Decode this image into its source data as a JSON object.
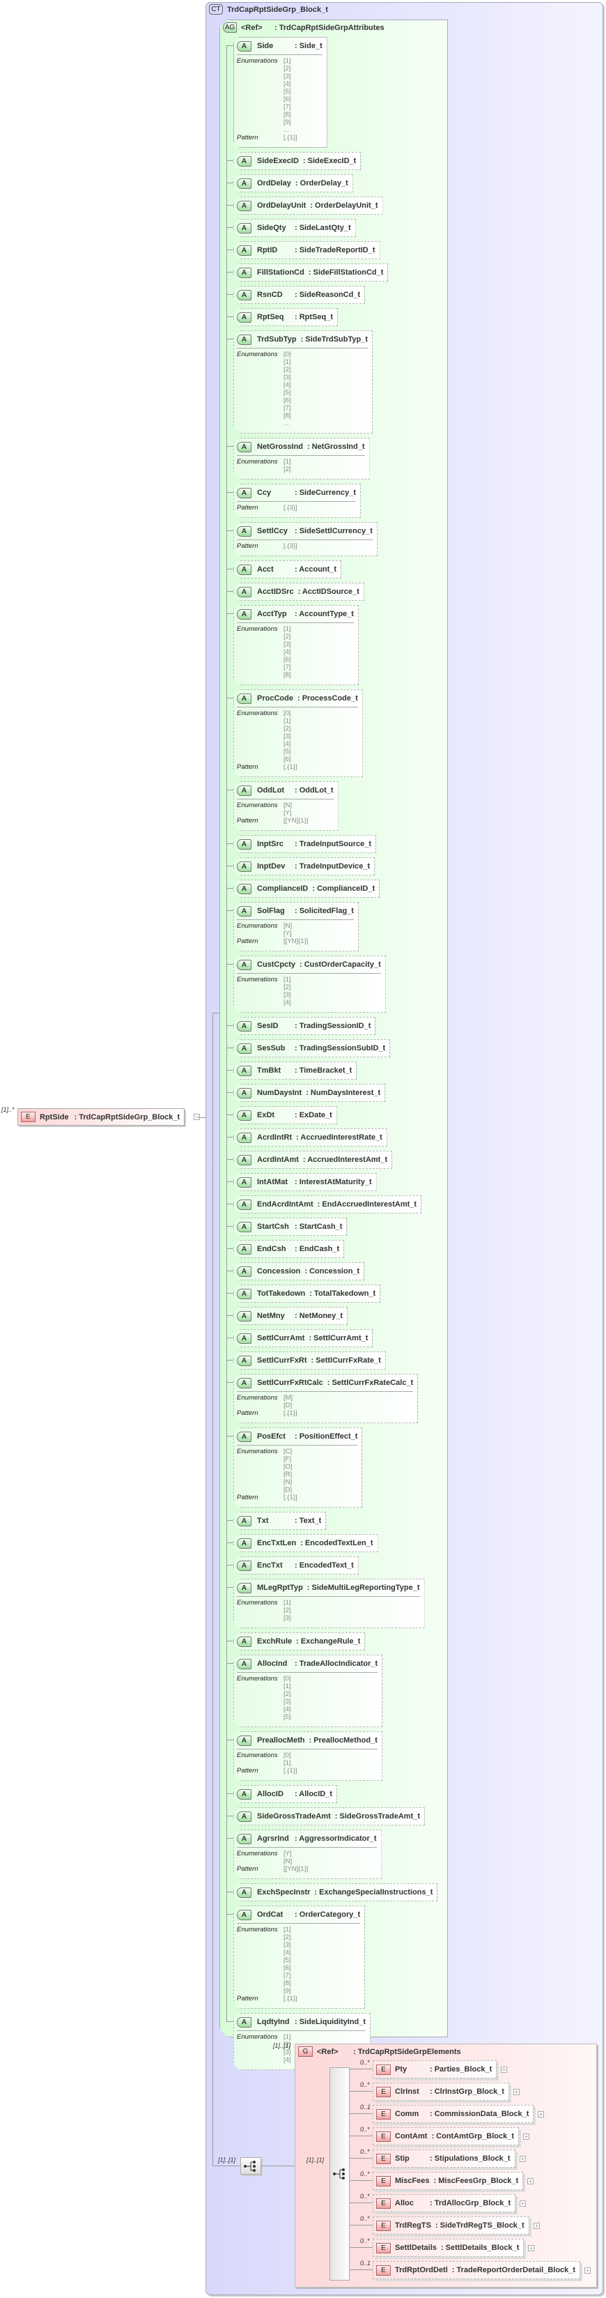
{
  "diagram": {
    "complex_type": {
      "badge": "CT",
      "name": "TrdCapRptSideGrp_Block_t"
    },
    "root_element": {
      "badge": "E",
      "name": "RptSide",
      "type": ": TrdCapRptSideGrp_Block_t",
      "multiplicity": "[1]..*",
      "toggle": "−"
    },
    "attribute_group": {
      "badge": "AG",
      "ref": "<Ref>",
      "type": ": TrdCapRptSideGrpAttributes"
    },
    "labels": {
      "enumerations": "Enumerations",
      "pattern": "Pattern",
      "attr_badge": "A",
      "elem_badge": "E",
      "expand": "+"
    },
    "attributes": [
      {
        "name": "Side",
        "type": ": Side_t",
        "required": true,
        "enumerations": [
          "[1]",
          "[2]",
          "[3]",
          "[4]",
          "[5]",
          "[6]",
          "[7]",
          "[8]",
          "[9]",
          "..."
        ],
        "pattern": "[.{1}]"
      },
      {
        "name": "SideExecID",
        "type": ": SideExecID_t"
      },
      {
        "name": "OrdDelay",
        "type": ": OrderDelay_t"
      },
      {
        "name": "OrdDelayUnit",
        "type": ": OrderDelayUnit_t"
      },
      {
        "name": "SideQty",
        "type": ": SideLastQty_t"
      },
      {
        "name": "RptID",
        "type": ": SideTradeReportID_t"
      },
      {
        "name": "FillStationCd",
        "type": ": SideFillStationCd_t"
      },
      {
        "name": "RsnCD",
        "type": ": SideReasonCd_t"
      },
      {
        "name": "RptSeq",
        "type": ": RptSeq_t"
      },
      {
        "name": "TrdSubTyp",
        "type": ": SideTrdSubTyp_t",
        "enumerations": [
          "[0]",
          "[1]",
          "[2]",
          "[3]",
          "[4]",
          "[5]",
          "[6]",
          "[7]",
          "[8]",
          "..."
        ]
      },
      {
        "name": "NetGrossInd",
        "type": ": NetGrossInd_t",
        "enumerations": [
          "[1]",
          "[2]"
        ]
      },
      {
        "name": "Ccy",
        "type": ": SideCurrency_t",
        "pattern": "[.{3}]"
      },
      {
        "name": "SettlCcy",
        "type": ": SideSettlCurrency_t",
        "pattern": "[.{3}]"
      },
      {
        "name": "Acct",
        "type": ": Account_t"
      },
      {
        "name": "AcctIDSrc",
        "type": ": AcctIDSource_t"
      },
      {
        "name": "AcctTyp",
        "type": ": AccountType_t",
        "enumerations": [
          "[1]",
          "[2]",
          "[3]",
          "[4]",
          "[6]",
          "[7]",
          "[8]"
        ]
      },
      {
        "name": "ProcCode",
        "type": ": ProcessCode_t",
        "enumerations": [
          "[0]",
          "[1]",
          "[2]",
          "[3]",
          "[4]",
          "[5]",
          "[6]"
        ],
        "pattern": "[.{1}]"
      },
      {
        "name": "OddLot",
        "type": ": OddLot_t",
        "enumerations": [
          "[N]",
          "[Y]"
        ],
        "pattern": "[[YN]{1}]"
      },
      {
        "name": "InptSrc",
        "type": ": TradeInputSource_t"
      },
      {
        "name": "InptDev",
        "type": ": TradeInputDevice_t"
      },
      {
        "name": "ComplianceID",
        "type": ": ComplianceID_t"
      },
      {
        "name": "SolFlag",
        "type": ": SolicitedFlag_t",
        "enumerations": [
          "[N]",
          "[Y]"
        ],
        "pattern": "[[YN]{1}]"
      },
      {
        "name": "CustCpcty",
        "type": ": CustOrderCapacity_t",
        "enumerations": [
          "[1]",
          "[2]",
          "[3]",
          "[4]"
        ]
      },
      {
        "name": "SesID",
        "type": ": TradingSessionID_t"
      },
      {
        "name": "SesSub",
        "type": ": TradingSessionSubID_t"
      },
      {
        "name": "TmBkt",
        "type": ": TimeBracket_t"
      },
      {
        "name": "NumDaysInt",
        "type": ": NumDaysInterest_t"
      },
      {
        "name": "ExDt",
        "type": ": ExDate_t"
      },
      {
        "name": "AcrdIntRt",
        "type": ": AccruedInterestRate_t"
      },
      {
        "name": "AcrdIntAmt",
        "type": ": AccruedInterestAmt_t"
      },
      {
        "name": "IntAtMat",
        "type": ": InterestAtMaturity_t"
      },
      {
        "name": "EndAcrdIntAmt",
        "type": ": EndAccruedInterestAmt_t"
      },
      {
        "name": "StartCsh",
        "type": ": StartCash_t"
      },
      {
        "name": "EndCsh",
        "type": ": EndCash_t"
      },
      {
        "name": "Concession",
        "type": ": Concession_t"
      },
      {
        "name": "TotTakedown",
        "type": ": TotalTakedown_t"
      },
      {
        "name": "NetMny",
        "type": ": NetMoney_t"
      },
      {
        "name": "SettlCurrAmt",
        "type": ": SettlCurrAmt_t"
      },
      {
        "name": "SettlCurrFxRt",
        "type": ": SettlCurrFxRate_t"
      },
      {
        "name": "SettlCurrFxRtCalc",
        "type": ": SettlCurrFxRateCalc_t",
        "enumerations": [
          "[M]",
          "[D]"
        ],
        "pattern": "[.{1}]"
      },
      {
        "name": "PosEfct",
        "type": ": PositionEffect_t",
        "enumerations": [
          "[C]",
          "[F]",
          "[O]",
          "[R]",
          "[N]",
          "[D]"
        ],
        "pattern": "[.{1}]"
      },
      {
        "name": "Txt",
        "type": ": Text_t"
      },
      {
        "name": "EncTxtLen",
        "type": ": EncodedTextLen_t"
      },
      {
        "name": "EncTxt",
        "type": ": EncodedText_t"
      },
      {
        "name": "MLegRptTyp",
        "type": ": SideMultiLegReportingType_t",
        "enumerations": [
          "[1]",
          "[2]",
          "[3]"
        ]
      },
      {
        "name": "ExchRule",
        "type": ": ExchangeRule_t"
      },
      {
        "name": "AllocInd",
        "type": ": TradeAllocIndicator_t",
        "enumerations": [
          "[0]",
          "[1]",
          "[2]",
          "[3]",
          "[4]",
          "[5]"
        ]
      },
      {
        "name": "PreallocMeth",
        "type": ": PreallocMethod_t",
        "enumerations": [
          "[0]",
          "[1]"
        ],
        "pattern": "[.{1}]"
      },
      {
        "name": "AllocID",
        "type": ": AllocID_t"
      },
      {
        "name": "SideGrossTradeAmt",
        "type": ": SideGrossTradeAmt_t"
      },
      {
        "name": "AgrsrInd",
        "type": ": AggressorIndicator_t",
        "enumerations": [
          "[Y]",
          "[N]"
        ],
        "pattern": "[[YN]{1}]"
      },
      {
        "name": "ExchSpecInstr",
        "type": ": ExchangeSpecialInstructions_t"
      },
      {
        "name": "OrdCat",
        "type": ": OrderCategory_t",
        "enumerations": [
          "[1]",
          "[2]",
          "[3]",
          "[4]",
          "[5]",
          "[6]",
          "[7]",
          "[8]",
          "[9]"
        ],
        "pattern": "[.{1}]"
      },
      {
        "name": "LqdtyInd",
        "type": ": SideLiquidityInd_t",
        "enumerations": [
          "[1]",
          "[2]",
          "[3]",
          "[4]"
        ]
      }
    ],
    "sequence_multiplicity": "[1]..[1]",
    "group": {
      "badge": "G",
      "ref": "<Ref>",
      "type": ": TrdCapRptSideGrpElements",
      "multiplicity": "[1]..[1]",
      "sequence_multiplicity": "[1]..[1]",
      "elements": [
        {
          "name": "Pty",
          "type": ": Parties_Block_t",
          "multiplicity": "0..*"
        },
        {
          "name": "ClrInst",
          "type": ": ClrInstGrp_Block_t",
          "multiplicity": "0..*"
        },
        {
          "name": "Comm",
          "type": ": CommissionData_Block_t",
          "multiplicity": "0..1"
        },
        {
          "name": "ContAmt",
          "type": ": ContAmtGrp_Block_t",
          "multiplicity": "0..*"
        },
        {
          "name": "Stip",
          "type": ": Stipulations_Block_t",
          "multiplicity": "0..*"
        },
        {
          "name": "MiscFees",
          "type": ": MiscFeesGrp_Block_t",
          "multiplicity": "0..*"
        },
        {
          "name": "Alloc",
          "type": ": TrdAllocGrp_Block_t",
          "multiplicity": "0..*"
        },
        {
          "name": "TrdRegTS",
          "type": ": SideTrdRegTS_Block_t",
          "multiplicity": "0..*"
        },
        {
          "name": "SettlDetails",
          "type": ": SettlDetails_Block_t",
          "multiplicity": "0..*"
        },
        {
          "name": "TrdRptOrdDetl",
          "type": ": TradeReportOrderDetail_Block_t",
          "multiplicity": "0..1"
        }
      ]
    }
  }
}
